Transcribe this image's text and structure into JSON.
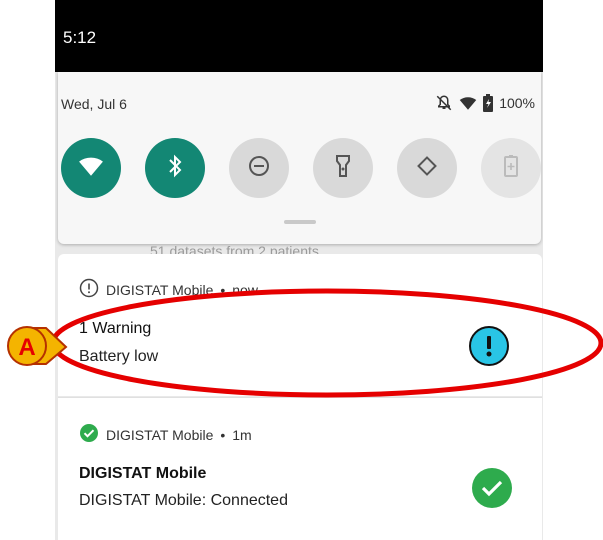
{
  "status_bar": {
    "time": "5:12"
  },
  "quick_settings": {
    "date": "Wed, Jul 6",
    "battery": "100%",
    "tiles": [
      {
        "icon": "wifi-icon",
        "state": "on"
      },
      {
        "icon": "bluetooth-icon",
        "state": "on"
      },
      {
        "icon": "do-not-disturb-icon",
        "state": "off"
      },
      {
        "icon": "flashlight-icon",
        "state": "off"
      },
      {
        "icon": "auto-rotate-icon",
        "state": "off"
      },
      {
        "icon": "battery-saver-icon",
        "state": "disabled"
      }
    ]
  },
  "peek_text": "51 datasets from 2 patients",
  "notifications": [
    {
      "app": "DIGISTAT Mobile",
      "time": "now",
      "title": "1 Warning",
      "body": "Battery low",
      "icon": "warning-icon",
      "icon_color": "#29c5e6"
    },
    {
      "app": "DIGISTAT Mobile",
      "time": "1m",
      "title": "DIGISTAT Mobile",
      "body": "DIGISTAT Mobile: Connected",
      "icon": "check-circle-icon",
      "icon_color": "#2eab4d"
    }
  ],
  "callout": {
    "label": "A",
    "color": "#e50000"
  }
}
